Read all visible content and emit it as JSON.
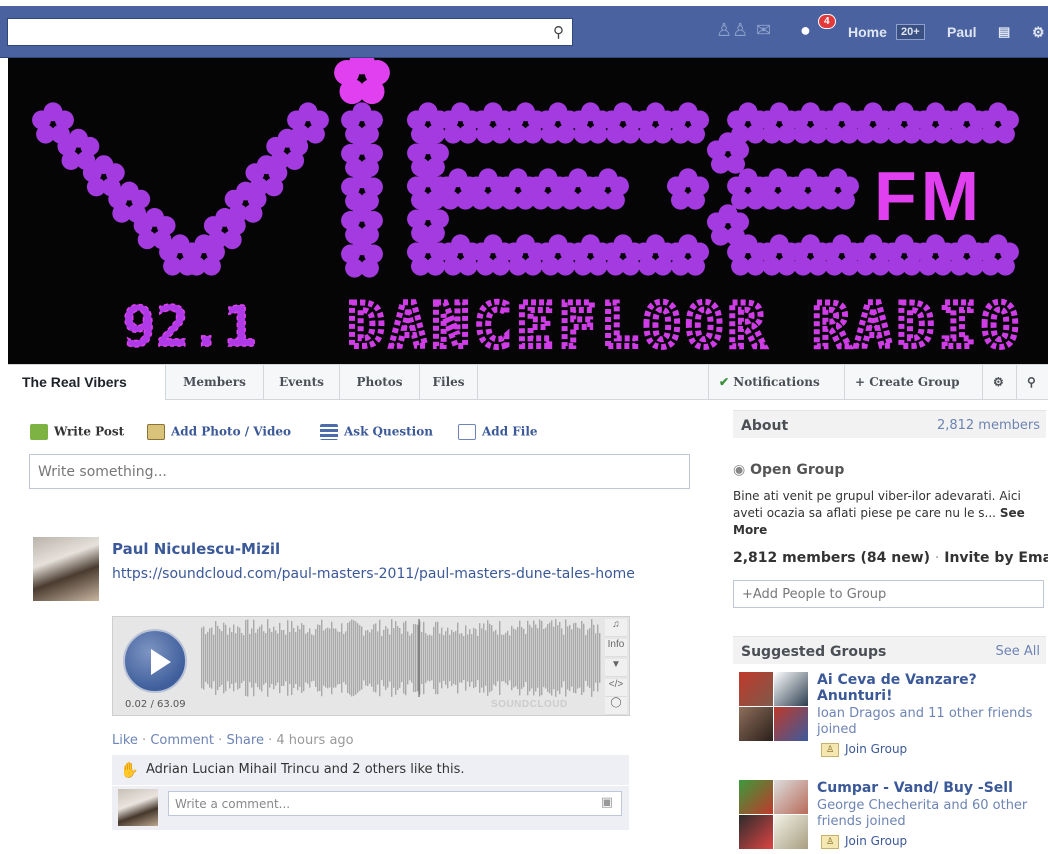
{
  "topbar": {
    "search_placeholder": "",
    "notification_count": "4",
    "home_label": "Home",
    "home_count": "20+",
    "user_name": "Paul"
  },
  "cover": {
    "logo_text": "vibe",
    "fm_text": "FM",
    "frequency": "92.1",
    "tagline": "DANCEFLOOR RADIO",
    "accent_color": "#c640e0"
  },
  "tabs": {
    "group_name": "The Real Vibers",
    "items": [
      "Members",
      "Events",
      "Photos",
      "Files"
    ],
    "notifications": "Notifications",
    "create_group": "+ Create Group"
  },
  "composer": {
    "write_post": "Write Post",
    "add_photo": "Add Photo / Video",
    "ask_question": "Ask Question",
    "add_file": "Add File",
    "placeholder": "Write something..."
  },
  "post": {
    "author": "Paul Niculescu-Mizil",
    "link": "https://soundcloud.com/paul-masters-2011/paul-masters-dune-tales-home",
    "player_time": "0.02 / 63.09",
    "player_brand": "SOUNDCLOUD",
    "player_info": "Info",
    "actions": {
      "like": "Like",
      "comment": "Comment",
      "share": "Share",
      "time": "4 hours ago"
    },
    "likes_text": "Adrian Lucian Mihail Trincu and 2 others like this.",
    "comment_placeholder": "Write a comment..."
  },
  "about": {
    "title": "About",
    "members_count": "2,812 members",
    "group_type": "Open Group",
    "description": "Bine ati venit pe grupul viber-ilor adevarati. Aici aveti ocazia sa aflati piese pe care nu le s...",
    "see_more": "See More",
    "members_line": "2,812 members",
    "new_count": "(84 new)",
    "invite": "Invite by Email",
    "add_people": "+Add People to Group"
  },
  "suggested": {
    "title": "Suggested Groups",
    "see_all": "See All",
    "groups": [
      {
        "name": "Ai Ceva de Vanzare? Anunturi!",
        "friends": "Ioan Dragos and 11 other friends joined",
        "join": "Join Group"
      },
      {
        "name": "Cumpar - Vand/ Buy -Sell",
        "friends": "George Checherita and 60 other friends joined",
        "join": "Join Group"
      }
    ]
  }
}
